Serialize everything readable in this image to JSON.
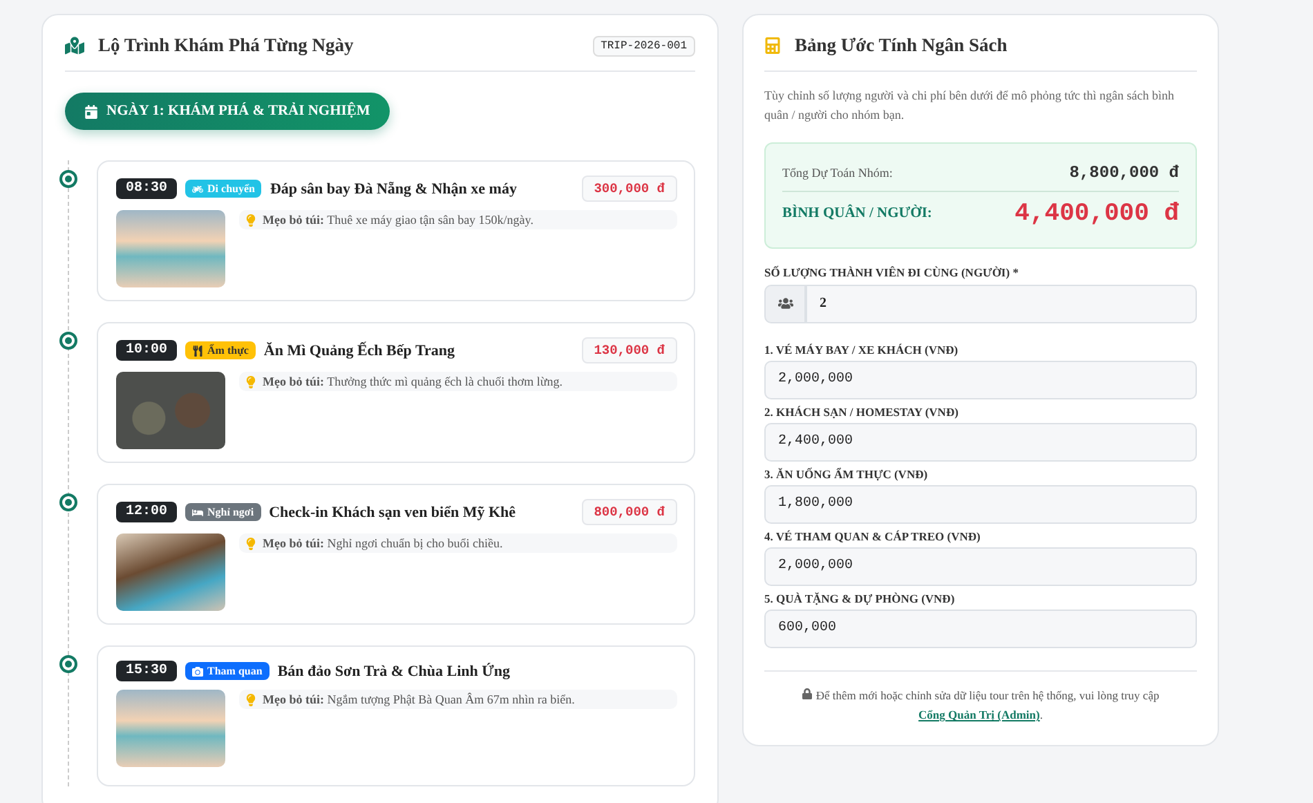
{
  "itinerary": {
    "title": "Lộ Trình Khám Phá Từng Ngày",
    "code": "TRIP-2026-001",
    "day_label": "NGÀY 1: KHÁM PHÁ & TRẢI NGHIỆM",
    "items": [
      {
        "time": "08:30",
        "tag": {
          "kind": "transport",
          "label": "Di chuyển",
          "color": "#22c3e6"
        },
        "title": "Đáp sân bay Đà Nẵng & Nhận xe máy",
        "price": "300,000 đ",
        "tip_label": "Mẹo bỏ túi:",
        "tip": "Thuê xe máy giao tận sân bay 150k/ngày.",
        "photo": {
          "kind": "beach"
        }
      },
      {
        "time": "10:00",
        "tag": {
          "kind": "food",
          "label": "Ẩm thực",
          "color": "#ffc107"
        },
        "title": "Ăn Mì Quảng Ếch Bếp Trang",
        "price": "130,000 đ",
        "tip_label": "Mẹo bỏ túi:",
        "tip": "Thưởng thức mì quảng ếch là chuối thơm lừng.",
        "photo": {
          "kind": "food"
        }
      },
      {
        "time": "12:00",
        "tag": {
          "kind": "rest",
          "label": "Nghỉ ngơi",
          "color": "#6c757d"
        },
        "title": "Check-in Khách sạn ven biển Mỹ Khê",
        "price": "800,000 đ",
        "tip_label": "Mẹo bỏ túi:",
        "tip": "Nghỉ ngơi chuẩn bị cho buổi chiều.",
        "photo": {
          "kind": "resort"
        }
      },
      {
        "time": "15:30",
        "tag": {
          "kind": "sightseeing",
          "label": "Tham quan",
          "color": "#0d6efd"
        },
        "title": "Bán đảo Sơn Trà & Chùa Linh Ứng",
        "tip_label": "Mẹo bỏ túi:",
        "tip": "Ngắm tượng Phật Bà Quan Âm 67m nhìn ra biển.",
        "photo": {
          "kind": "beach"
        }
      }
    ]
  },
  "budget": {
    "title": "Bảng Ước Tính Ngân Sách",
    "description": "Tùy chỉnh số lượng người và chi phí bên dưới để mô phỏng tức thì ngân sách bình quân / người cho nhóm bạn.",
    "total_label": "Tổng Dự Toán Nhóm:",
    "total": "8,800,000 đ",
    "per_person_label": "BÌNH QUÂN / NGƯỜI:",
    "per_person": "4,400,000 đ",
    "members_label": "SỐ LƯỢNG THÀNH VIÊN ĐI CÙNG (NGƯỜI) *",
    "members": "2",
    "costs": [
      {
        "label": "1. VÉ MÁY BAY / XE KHÁCH (VNĐ)",
        "value": "2,000,000"
      },
      {
        "label": "2. KHÁCH SẠN / HOMESTAY (VNĐ)",
        "value": "2,400,000"
      },
      {
        "label": "3. ĂN UỐNG ẨM THỰC (VNĐ)",
        "value": "1,800,000"
      },
      {
        "label": "4. VÉ THAM QUAN & CÁP TREO (VNĐ)",
        "value": "2,000,000"
      },
      {
        "label": "5. QUÀ TẶNG & DỰ PHÒNG (VNĐ)",
        "value": "600,000"
      }
    ],
    "note": "Để thêm mới hoặc chỉnh sửa dữ liệu tour trên hệ thống, vui lòng truy cập",
    "note_link": "Cổng Quản Trị (Admin)",
    "note_end": "."
  }
}
